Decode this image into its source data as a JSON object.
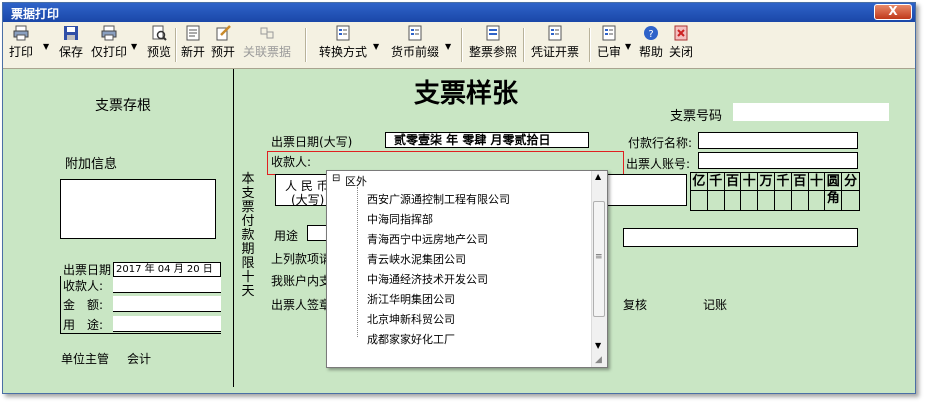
{
  "window": {
    "title": "票据打印",
    "close_glyph": "X"
  },
  "toolbar": {
    "print": "打印",
    "save": "保存",
    "print_only": "仅打印",
    "preview": "预览",
    "new": "新开",
    "pre_open": "预开",
    "linked_bill": "关联票据",
    "convert_mode": "转换方式",
    "currency_prefix": "货币前缀",
    "form_reference": "整票参照",
    "voucher_issue": "凭证开票",
    "approved": "已审",
    "help": "帮助",
    "close": "关闭"
  },
  "stub": {
    "title": "支票存根",
    "extra_info": "附加信息",
    "date_label": "出票日期",
    "date_value": "2017 年 04 月 20 日",
    "payee": "收款人:",
    "amount": "金　额:",
    "purpose": "用　途:",
    "unit_head": "单位主管",
    "accountant": "会计"
  },
  "cheque": {
    "title": "支票样张",
    "cheque_no_label": "支票号码",
    "issue_date_label": "出票日期(大写)",
    "issue_date_value": "贰零壹柒 年  零肆  月零贰拾日",
    "payer_bank_label": "付款行名称:",
    "payee_label": "收款人:",
    "drawer_account_label": "出票人账号:",
    "validity_vertical": "本支票付款期限十天",
    "rmb_label": "人 民 币",
    "rmb_caps": "(大写)",
    "purpose_label": "用途",
    "above_label": "上列款项请",
    "my_account_label": "我账户内支",
    "signature_label": "出票人签章",
    "review": "复核",
    "bookkeeping": "记账",
    "amount_units": [
      "亿",
      "千",
      "百",
      "十",
      "万",
      "千",
      "百",
      "十",
      "圆",
      "角",
      "分"
    ]
  },
  "payee_dropdown": {
    "root": "区外",
    "items": [
      "西安广源通控制工程有限公司",
      "中海同指挥部",
      "青海西宁中远房地产公司",
      "青云峡水泥集团公司",
      "中海通经济技术开发公司",
      "浙江华明集团公司",
      "北京坤新科贸公司",
      "成都家家好化工厂"
    ]
  }
}
